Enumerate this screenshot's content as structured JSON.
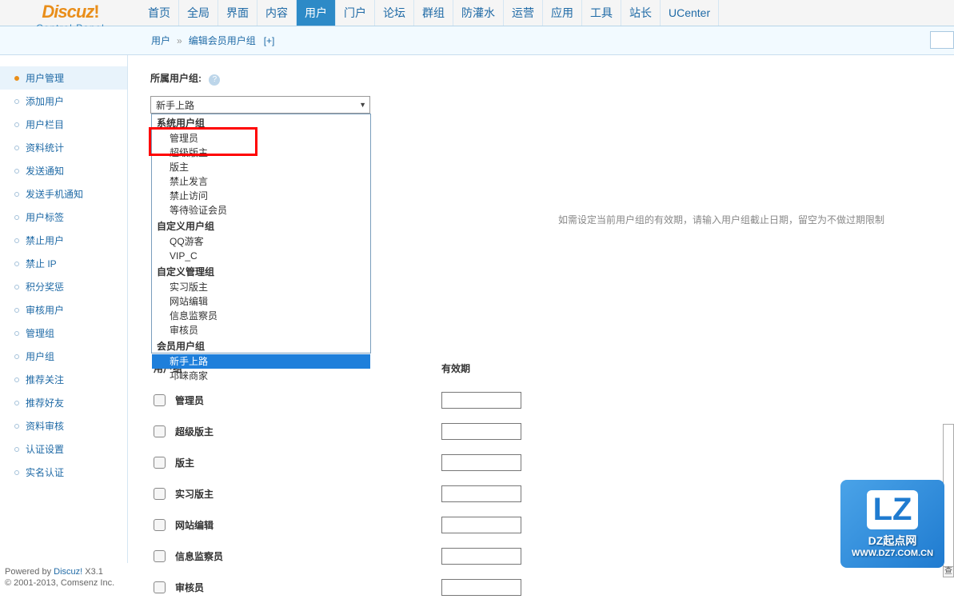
{
  "logo": {
    "text": "Discuz",
    "bang": "!",
    "sub": "Control Panel"
  },
  "topnav": {
    "items": [
      {
        "label": "首页"
      },
      {
        "label": "全局"
      },
      {
        "label": "界面"
      },
      {
        "label": "内容"
      },
      {
        "label": "用户",
        "active": true
      },
      {
        "label": "门户"
      },
      {
        "label": "论坛"
      },
      {
        "label": "群组"
      },
      {
        "label": "防灌水"
      },
      {
        "label": "运营"
      },
      {
        "label": "应用"
      },
      {
        "label": "工具"
      },
      {
        "label": "站长"
      },
      {
        "label": "UCenter"
      }
    ]
  },
  "breadcrumb": {
    "a": "用户",
    "sep": "»",
    "b": "编辑会员用户组",
    "plus": "[+]"
  },
  "sidebar": {
    "items": [
      {
        "label": "用户管理",
        "active": true
      },
      {
        "label": "添加用户"
      },
      {
        "label": "用户栏目"
      },
      {
        "label": "资料统计"
      },
      {
        "label": "发送通知"
      },
      {
        "label": "发送手机通知"
      },
      {
        "label": "用户标签"
      },
      {
        "label": "禁止用户"
      },
      {
        "label": "禁止 IP"
      },
      {
        "label": "积分奖惩"
      },
      {
        "label": "审核用户"
      },
      {
        "label": "管理组"
      },
      {
        "label": "用户组"
      },
      {
        "label": "推荐关注"
      },
      {
        "label": "推荐好友"
      },
      {
        "label": "资料审核"
      },
      {
        "label": "认证设置"
      },
      {
        "label": "实名认证"
      }
    ]
  },
  "form": {
    "section_label": "所属用户组:",
    "selected": "新手上路",
    "hint": "如需设定当前用户组的有效期，请输入用户组截止日期，留空为不做过期限制",
    "dropdown_groups": [
      {
        "label": "系统用户组",
        "options": [
          "管理员",
          "超级版主",
          "版主",
          "禁止发言",
          "禁止访问",
          "等待验证会员"
        ]
      },
      {
        "label": "自定义用户组",
        "options": [
          "QQ游客",
          "VIP_C"
        ]
      },
      {
        "label": "自定义管理组",
        "options": [
          "实习版主",
          "网站编辑",
          "信息监察员",
          "审核员"
        ]
      },
      {
        "label": "会员用户组",
        "options": [
          "新手上路",
          "邛崃商家"
        ]
      }
    ]
  },
  "table": {
    "head": {
      "col1": "用户组",
      "col2": "有效期"
    },
    "rows": [
      {
        "label": "管理员"
      },
      {
        "label": "超级版主"
      },
      {
        "label": "版主"
      },
      {
        "label": "实习版主"
      },
      {
        "label": "网站编辑"
      },
      {
        "label": "信息监察员"
      },
      {
        "label": "审核员"
      }
    ]
  },
  "footer": {
    "line1a": "Powered by ",
    "line1b": "Discuz!",
    "line1c": " X3.1",
    "line2": "© 2001-2013, Comsenz Inc."
  },
  "watermark": {
    "logo": "LZ",
    "line1": "DZ起点网",
    "line2": "WWW.DZ7.COM.CN"
  },
  "right_btn": "查"
}
